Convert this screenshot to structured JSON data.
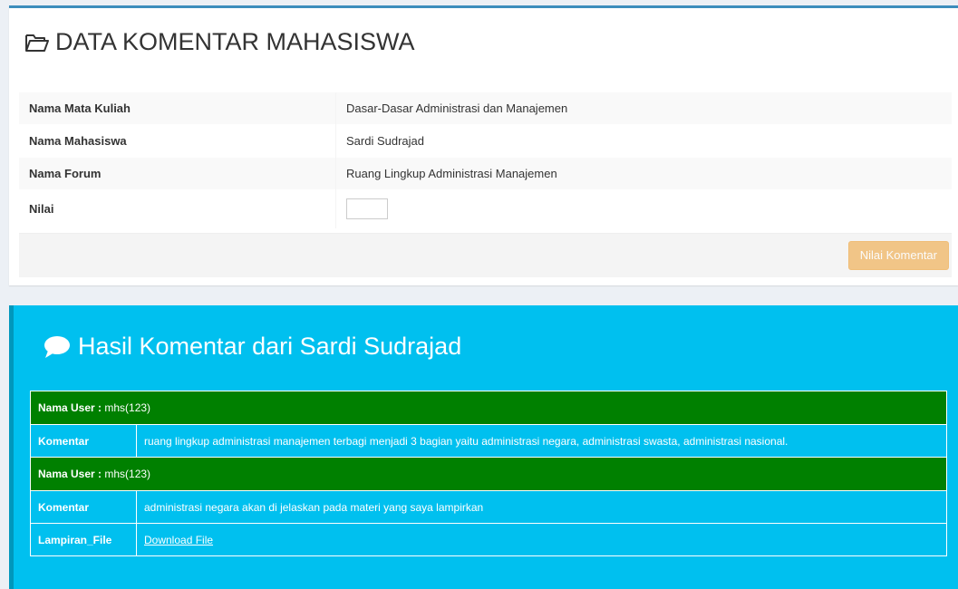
{
  "header": {
    "title": "DATA KOMENTAR MAHASISWA",
    "icon": "folder-open-icon"
  },
  "info": {
    "rows": [
      {
        "label": "Nama Mata Kuliah",
        "value": "Dasar-Dasar Administrasi dan Manajemen"
      },
      {
        "label": "Nama Mahasiswa",
        "value": "Sardi Sudrajad"
      },
      {
        "label": "Nama Forum",
        "value": "Ruang Lingkup Administrasi Manajemen"
      },
      {
        "label": "Nilai",
        "value": ""
      }
    ],
    "nilai_value": "",
    "button_label": "Nilai Komentar"
  },
  "hasil": {
    "title": "Hasil Komentar dari Sardi Sudrajad",
    "icon": "comment-icon",
    "entries": [
      {
        "user_label": "Nama User :",
        "user_value": " mhs(123)",
        "komentar_label": "Komentar",
        "komentar_value": "ruang lingkup administrasi manajemen terbagi menjadi 3 bagian yaitu administrasi negara, administrasi swasta, administrasi nasional."
      },
      {
        "user_label": "Nama User :",
        "user_value": " mhs(123)",
        "komentar_label": "Komentar",
        "komentar_value": "administrasi negara akan di jelaskan pada materi yang saya lampirkan",
        "lampiran_label": "Lampiran_File",
        "lampiran_link": "Download File"
      }
    ]
  },
  "colors": {
    "top_border": "#3c8dbc",
    "info_bg": "#00c0ef",
    "user_row_bg": "#008000",
    "warning_btn": "#f0ad4e"
  }
}
